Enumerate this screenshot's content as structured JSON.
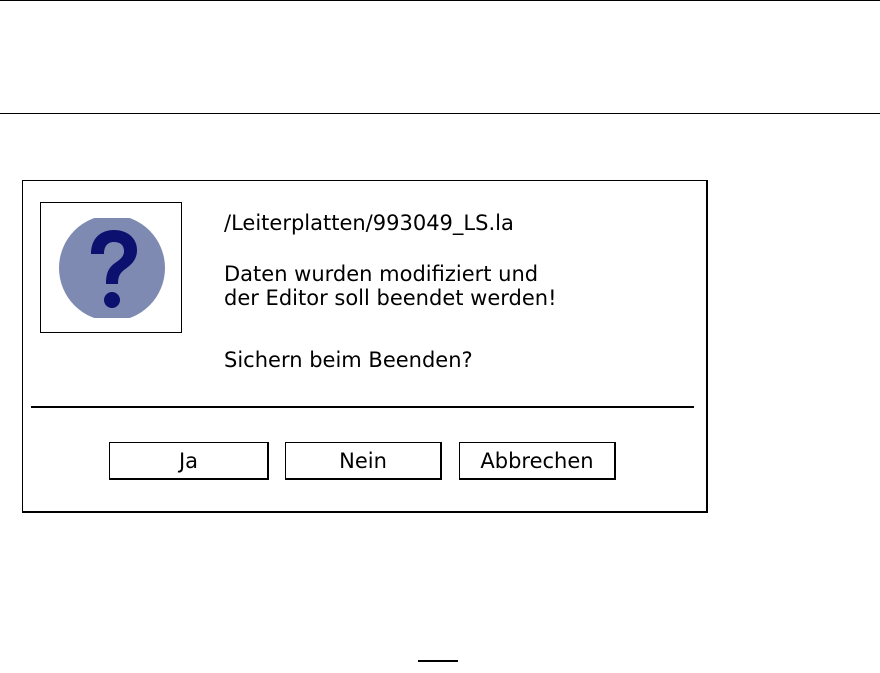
{
  "dialog": {
    "file_path": "/Leiterplatten/993049_LS.la",
    "message_line1": "Daten wurden modifiziert und",
    "message_line2": "der Editor soll beendet werden!",
    "question": "Sichern beim Beenden?",
    "icon": "question-mark-icon",
    "icon_colors": {
      "circle": "#7f8ab3",
      "glyph": "#0c106e"
    },
    "buttons": {
      "yes_label": "Ja",
      "no_label": "Nein",
      "cancel_label": "Abbrechen"
    }
  }
}
